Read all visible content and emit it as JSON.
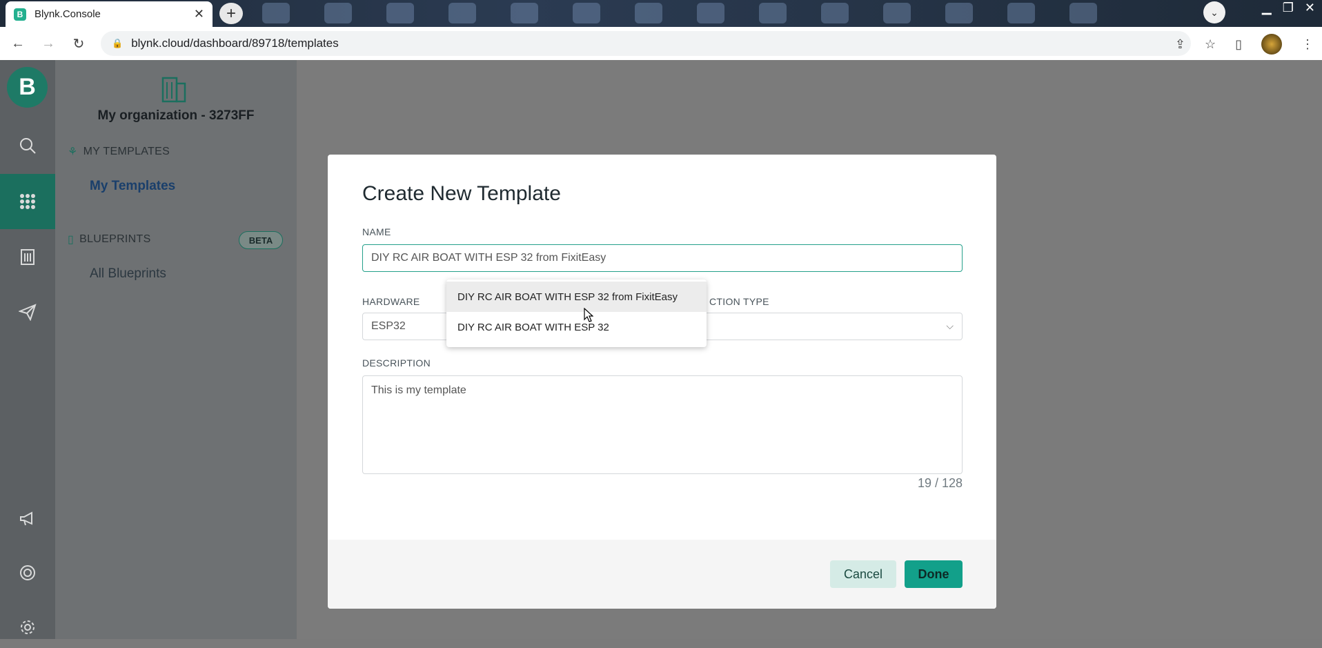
{
  "browser": {
    "tab_title": "Blynk.Console",
    "favicon_letter": "B",
    "url": "blynk.cloud/dashboard/89718/templates"
  },
  "rail": {
    "logo_letter": "B",
    "icons": [
      "search-icon",
      "apps-grid-icon",
      "building-icon",
      "send-icon",
      "megaphone-icon",
      "help-ring-icon",
      "settings-icon"
    ]
  },
  "sidebar": {
    "org_name": "My organization - 3273FF",
    "my_templates_heading": "MY TEMPLATES",
    "my_templates_link": "My Templates",
    "blueprints_heading": "BLUEPRINTS",
    "beta_badge": "BETA",
    "all_blueprints_link": "All Blueprints"
  },
  "modal": {
    "title": "Create New Template",
    "name_label": "NAME",
    "name_value": "DIY RC AIR BOAT WITH ESP 32 from FixitEasy",
    "hardware_label": "HARDWARE",
    "hardware_value": "ESP32",
    "connection_label": "CONNECTION TYPE",
    "connection_label_visible": "CTION TYPE",
    "description_label": "DESCRIPTION",
    "description_value": "This is my template",
    "char_counter": "19 / 128",
    "cancel_label": "Cancel",
    "done_label": "Done"
  },
  "autocomplete": {
    "options": [
      "DIY RC AIR BOAT WITH ESP 32 from FixitEasy",
      "DIY RC AIR BOAT WITH ESP 32"
    ]
  }
}
